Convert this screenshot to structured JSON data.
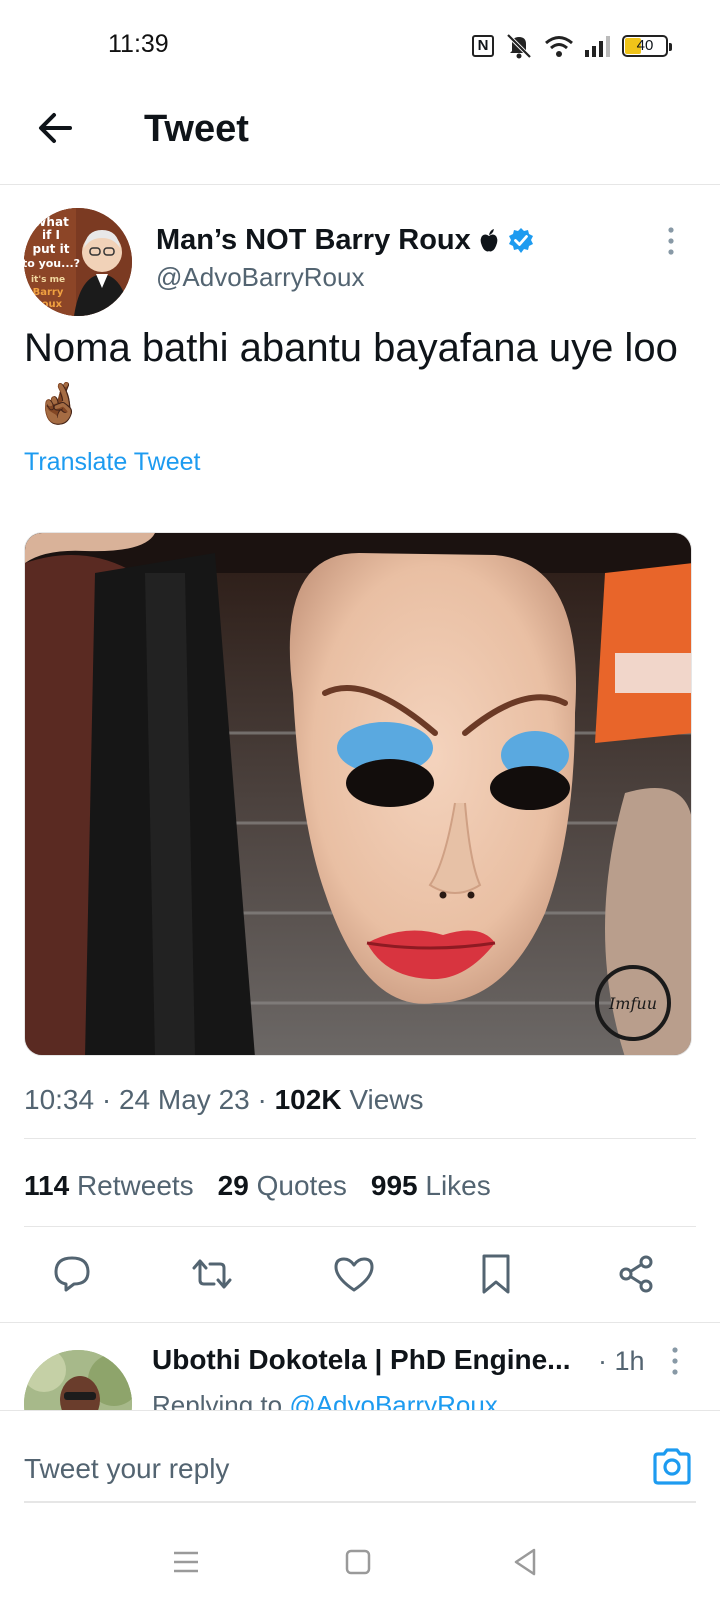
{
  "status_bar": {
    "time": "11:39",
    "nfc_label": "N",
    "battery_level": "40"
  },
  "header": {
    "title": "Tweet"
  },
  "tweet": {
    "author_name": "Man’s NOT Barry Roux",
    "author_handle": "@AdvoBarryRoux",
    "text": "Noma bathi abantu bayafana uye loo",
    "emoji": "🤞🏾",
    "translate_label": "Translate Tweet",
    "time": "10:34",
    "date": "24 May 23",
    "views_count": "102K",
    "views_label": "Views",
    "avatar_caption": [
      "What",
      "if I",
      "put it",
      "to you...?",
      "it's me",
      "Barry",
      "Roux"
    ],
    "media_watermark": "Imfuu"
  },
  "stats": {
    "retweets_count": "114",
    "retweets_label": "Retweets",
    "quotes_count": "29",
    "quotes_label": "Quotes",
    "likes_count": "995",
    "likes_label": "Likes"
  },
  "reply": {
    "author_name": "Ubothi Dokotela | PhD Engine...",
    "time": "· 1h",
    "context_prefix": "Replying to",
    "context_handle": "@AdvoBarryRoux"
  },
  "compose": {
    "placeholder": "Tweet your reply"
  },
  "colors": {
    "accent": "#1d9bf0",
    "secondary_text": "#536471",
    "primary_text": "#0f1419",
    "divider": "#e6e6e6"
  },
  "icons": {
    "back": "arrow-left-icon",
    "apple": "apple-icon",
    "verified": "verified-badge-icon",
    "more": "more-vertical-icon",
    "reply": "reply-icon",
    "retweet": "retweet-icon",
    "like": "heart-icon",
    "bookmark": "bookmark-icon",
    "share": "share-icon",
    "camera": "camera-icon",
    "nav_menu": "menu-icon",
    "nav_home": "home-square-icon",
    "nav_back": "back-triangle-icon"
  }
}
